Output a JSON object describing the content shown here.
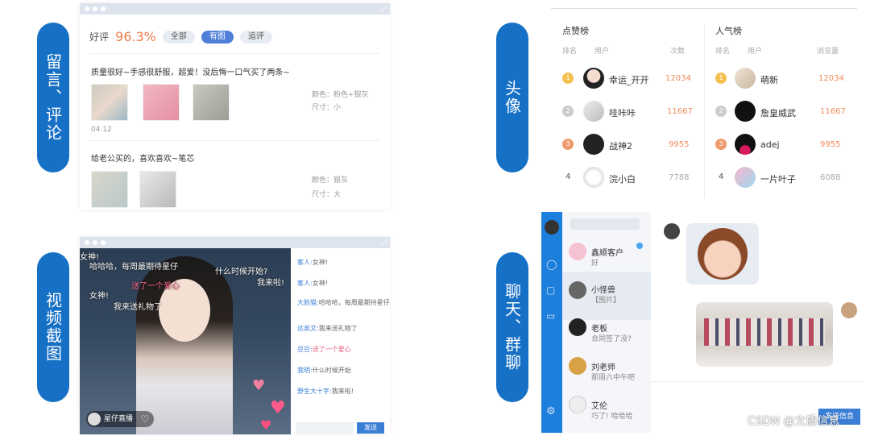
{
  "labels": {
    "comments": "留言、评论",
    "avatar": "头像",
    "video": "视频截图",
    "chat": "聊天、群聊"
  },
  "reviews": {
    "good_label": "好评",
    "good_rate": "96.3%",
    "tabs": [
      "全部",
      "有图",
      "追评"
    ],
    "items": [
      {
        "text": "质量很好~手感很舒服，超爱！没后悔一口气买了两条~",
        "color": "颜色：粉色+银灰",
        "size": "尺寸：小",
        "date": "04.12"
      },
      {
        "text": "给老公买的，喜欢喜欢~笔芯",
        "color": "颜色：银灰",
        "size": "尺寸：大",
        "date": ""
      }
    ]
  },
  "rankings": {
    "likes": {
      "title": "点赞榜",
      "cols": [
        "排名",
        "用户",
        "次数"
      ],
      "rows": [
        {
          "rank": "1",
          "name": "幸运_开开",
          "count": "12034"
        },
        {
          "rank": "2",
          "name": "哇咔咔",
          "count": "11667"
        },
        {
          "rank": "3",
          "name": "战神2",
          "count": "9955"
        },
        {
          "rank": "4",
          "name": "浣小白",
          "count": "7788"
        }
      ]
    },
    "popular": {
      "title": "人气榜",
      "cols": [
        "排名",
        "用户",
        "浏览量"
      ],
      "rows": [
        {
          "rank": "1",
          "name": "萌新",
          "count": "12034"
        },
        {
          "rank": "2",
          "name": "詹皇威武",
          "count": "11667"
        },
        {
          "rank": "3",
          "name": "adej",
          "count": "9955"
        },
        {
          "rank": "4",
          "name": "一片叶子",
          "count": "6088"
        }
      ]
    }
  },
  "video": {
    "overlay": [
      "女神!",
      "哈哈哈，每周最期待星仔",
      "什么时候开始?",
      "送了一个爱心",
      "我来啦!",
      "女神!",
      "我来送礼物了"
    ],
    "comments": [
      {
        "user": "客人:",
        "text": "女神!"
      },
      {
        "user": "客人:",
        "text": "女神!"
      },
      {
        "user": "大脸猫:",
        "text": "哈哈哈，每周最期待星仔"
      },
      {
        "user": "达英文:",
        "text": "我来送礼物了"
      },
      {
        "user": "豆豆:",
        "text": "送了一个爱心"
      },
      {
        "user": "我明:",
        "text": "什么时候开始"
      },
      {
        "user": "野生大十字:",
        "text": "我来啦!"
      }
    ],
    "host": "星仔直播",
    "send": "发送"
  },
  "chat": {
    "list": [
      {
        "title": "鑫顺客户",
        "sub": "好"
      },
      {
        "title": "小怪兽",
        "sub": "【图片】"
      },
      {
        "title": "老板",
        "sub": "合同签了没?"
      },
      {
        "title": "刘老师",
        "sub": "那周六中午吧"
      },
      {
        "title": "艾伦",
        "sub": "巧了! 哈哈哈"
      }
    ],
    "send": "发送信息"
  },
  "watermark": "CSDN @文盾信息"
}
